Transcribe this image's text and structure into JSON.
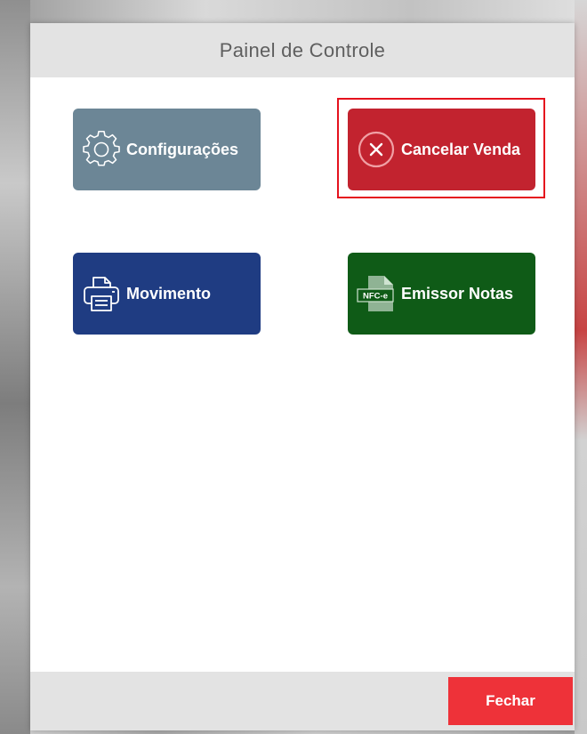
{
  "dialog": {
    "title": "Painel de Controle"
  },
  "tiles": [
    {
      "id": "config",
      "label": "Configurações",
      "icon": "gear-icon",
      "color": "#6c8696"
    },
    {
      "id": "cancel",
      "label": "Cancelar Venda",
      "icon": "cancel-circle-icon",
      "color": "#c2232f",
      "highlighted": true,
      "highlight_color": "#e5121d"
    },
    {
      "id": "movement",
      "label": "Movimento",
      "icon": "printer-icon",
      "color": "#1f3c82"
    },
    {
      "id": "nfce",
      "label": "Emissor Notas",
      "icon": "nfce-document-icon",
      "icon_text": "NFC-e",
      "color": "#0f5b17"
    }
  ],
  "footer": {
    "close_label": "Fechar",
    "close_color": "#ee3239"
  }
}
